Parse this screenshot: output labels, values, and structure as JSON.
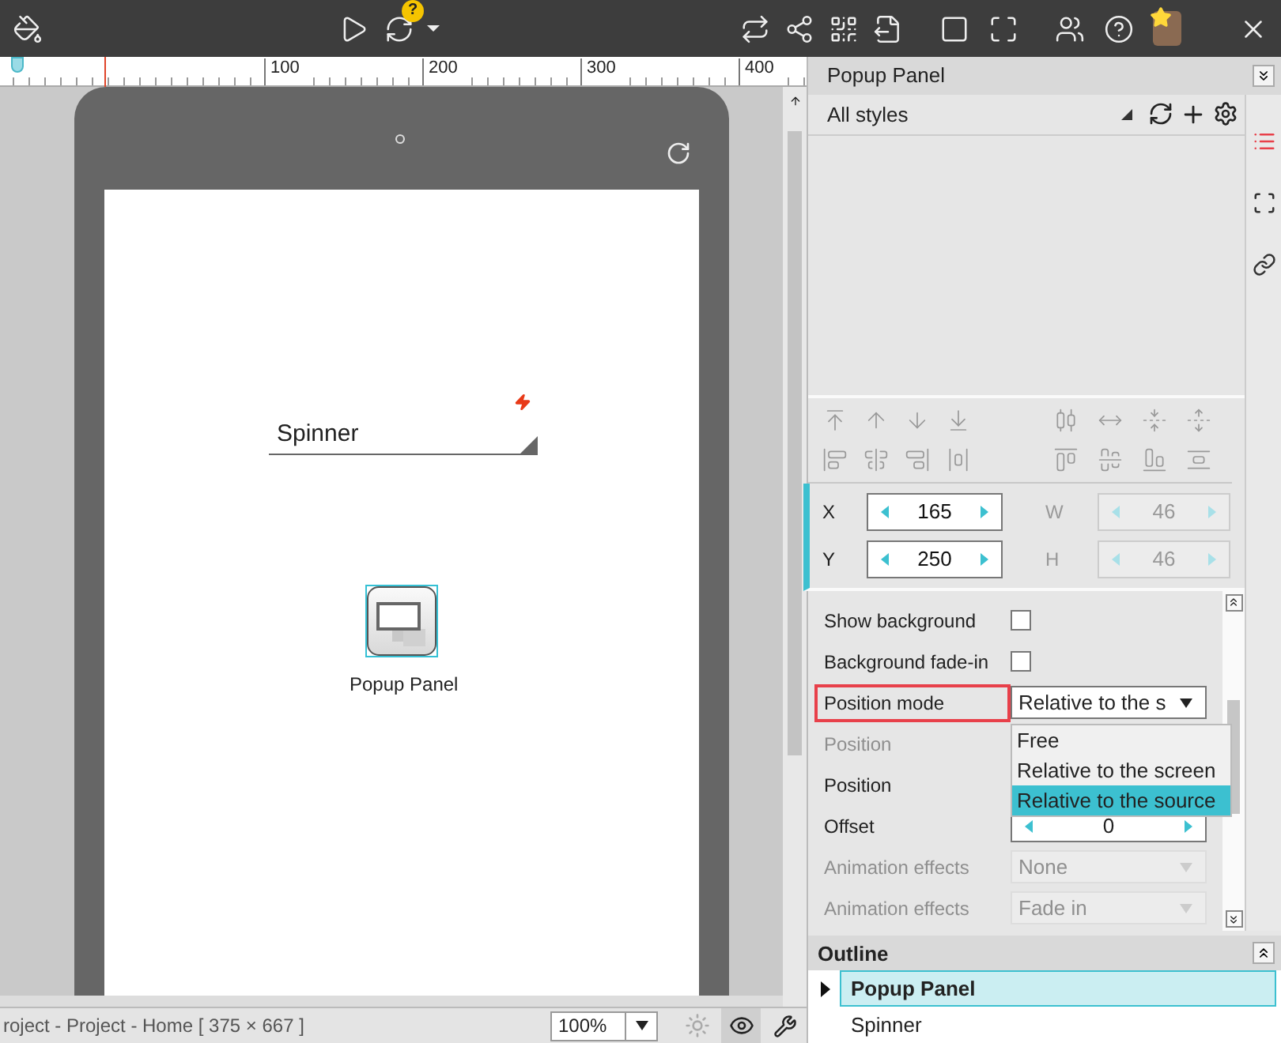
{
  "toolbar": {
    "badge": "?"
  },
  "ruler": {
    "ticks": [
      "100",
      "200",
      "300",
      "400"
    ]
  },
  "canvas": {
    "widgets": [
      {
        "kind": "spinner",
        "label": "Spinner",
        "selected": false
      },
      {
        "kind": "popup",
        "label": "Popup Panel",
        "selected": true
      }
    ]
  },
  "status_bar": {
    "path": "roject - Project - Home [ 375 × 667 ]",
    "zoom": "100%",
    "tools": [
      {
        "kind": "brightness",
        "pressed": false
      },
      {
        "kind": "preview",
        "pressed": true
      },
      {
        "kind": "tools",
        "pressed": false
      }
    ]
  },
  "panel": {
    "title": "Popup Panel",
    "style_select": "All styles"
  },
  "geometry": [
    {
      "label": "X",
      "value": "165",
      "disabled": false
    },
    {
      "label": "W",
      "value": "46",
      "disabled": true
    },
    {
      "label": "Y",
      "value": "250",
      "disabled": false
    },
    {
      "label": "H",
      "value": "46",
      "disabled": true
    }
  ],
  "properties": [
    {
      "kind": "checkbox",
      "label": "Show background",
      "checked": false,
      "disabled": false,
      "highlighted": false
    },
    {
      "kind": "checkbox",
      "label": "Background fade-in",
      "checked": false,
      "disabled": false,
      "highlighted": false
    },
    {
      "kind": "dropdown",
      "label": "Position mode",
      "value": "Relative to the s",
      "disabled": false,
      "highlighted": true
    },
    {
      "kind": "label",
      "label": "Position",
      "disabled": true,
      "highlighted": false
    },
    {
      "kind": "label",
      "label": "Position",
      "disabled": false,
      "highlighted": false
    },
    {
      "kind": "stepper",
      "label": "Offset",
      "value": "0",
      "disabled": false,
      "highlighted": false
    },
    {
      "kind": "dropdown",
      "label": "Animation effects",
      "value": "None",
      "disabled": true,
      "highlighted": false
    },
    {
      "kind": "dropdown",
      "label": "Animation effects",
      "value": "Fade in",
      "disabled": true,
      "highlighted": false
    }
  ],
  "dropdown_menu": {
    "options": [
      {
        "label": "Free",
        "selected": false
      },
      {
        "label": "Relative to the screen",
        "selected": false
      },
      {
        "label": "Relative to the source",
        "selected": true
      }
    ]
  },
  "outline": {
    "title": "Outline",
    "items": [
      {
        "label": "Popup Panel",
        "selected": true,
        "expanded": false
      },
      {
        "label": "Spinner",
        "selected": false
      }
    ]
  }
}
